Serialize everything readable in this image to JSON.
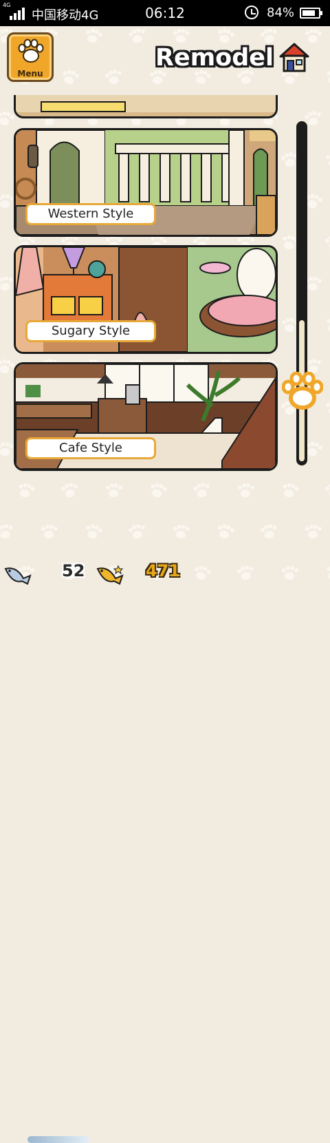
{
  "status_bar": {
    "network": "4G",
    "carrier": "中国移动4G",
    "time": "06:12",
    "battery_percent": "84%",
    "battery_level": 0.84
  },
  "menu": {
    "label": "Menu",
    "icon": "paw-icon"
  },
  "header": {
    "title": "Remodel",
    "icon": "house-icon"
  },
  "styles": [
    {
      "label": "Western Style"
    },
    {
      "label": "Sugary Style"
    },
    {
      "label": "Cafe Style"
    }
  ],
  "scroll": {
    "position": 0.42
  },
  "currency": {
    "silver_fish": "52",
    "gold_fish": "471"
  },
  "colors": {
    "accent": "#f0a729",
    "border": "#1c1c1c",
    "background": "#f2ece0"
  }
}
